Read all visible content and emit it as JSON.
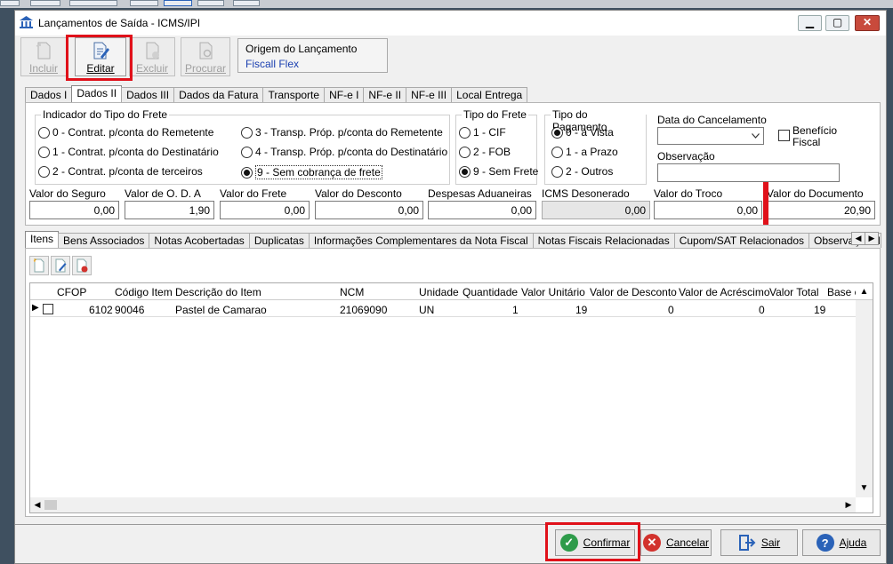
{
  "window": {
    "title": "Lançamentos de Saída - ICMS/IPI",
    "minimize": "▁",
    "maximize": "▢",
    "close": "✕"
  },
  "toolbar": {
    "incluir": "Incluir",
    "editar": "Editar",
    "excluir": "Excluir",
    "procurar": "Procurar"
  },
  "origin": {
    "label": "Origem do Lançamento",
    "value": "Fiscall Flex"
  },
  "tabs": [
    "Dados I",
    "Dados II",
    "Dados III",
    "Dados da Fatura",
    "Transporte",
    "NF-e I",
    "NF-e II",
    "NF-e III",
    "Local Entrega"
  ],
  "frete": {
    "title": "Indicador do Tipo do Frete",
    "options": [
      "0 - Contrat. p/conta do Remetente",
      "1 - Contrat. p/conta do Destinatário",
      "2 - Contrat. p/conta de terceiros",
      "3 - Transp. Próp. p/conta do Remetente",
      "4 - Transp. Próp. p/conta do Destinatário",
      "9 - Sem cobrança de frete"
    ],
    "selected": "9 - Sem cobrança de frete"
  },
  "tipo_frete": {
    "title": "Tipo do Frete",
    "options": [
      "1 - CIF",
      "2 - FOB",
      "9 - Sem Frete"
    ],
    "selected": "9 - Sem Frete"
  },
  "tipo_pagamento": {
    "title": "Tipo do Pagamento",
    "options": [
      "0 - à Vista",
      "1 - a Prazo",
      "2 - Outros"
    ],
    "selected": "0 - à Vista"
  },
  "cancelamento": {
    "label": "Data do Cancelamento",
    "value": ""
  },
  "beneficio": {
    "label1": "Benefício",
    "label2": "Fiscal",
    "checked": false
  },
  "observacao": {
    "label": "Observação",
    "value": ""
  },
  "valores": [
    {
      "label": "Valor do Seguro",
      "value": "0,00"
    },
    {
      "label": "Valor de O. D. A",
      "value": "1,90"
    },
    {
      "label": "Valor do Frete",
      "value": "0,00"
    },
    {
      "label": "Valor do Desconto",
      "value": "0,00"
    },
    {
      "label": "Despesas Aduaneiras",
      "value": "0,00"
    },
    {
      "label": "ICMS Desonerado",
      "value": "0,00"
    },
    {
      "label": "Valor do Troco",
      "value": "0,00"
    },
    {
      "label": "Valor do Documento",
      "value": "20,90"
    }
  ],
  "subtabs": [
    "Itens",
    "Bens Associados",
    "Notas Acobertadas",
    "Duplicatas",
    "Informações Complementares da Nota Fiscal",
    "Notas Fiscais Relacionadas",
    "Cupom/SAT Relacionados",
    "Observação de"
  ],
  "grid": {
    "columns": [
      "CFOP",
      "Código Item",
      "Descrição do Item",
      "NCM",
      "Unidade",
      "Quantidade",
      "Valor Unitário",
      "Valor de Desconto",
      "Valor de Acréscimo",
      "Valor Total",
      "Base c"
    ],
    "rows": [
      [
        "6102",
        "90046",
        "Pastel de Camarao",
        "21069090",
        "UN",
        "1",
        "19",
        "0",
        "0",
        "19",
        ""
      ]
    ]
  },
  "buttons": {
    "confirmar": "Confirmar",
    "cancelar": "Cancelar",
    "sair": "Sair",
    "ajuda": "Ajuda"
  },
  "colors": {
    "highlight": "#e0111a",
    "link": "#1a3fb0",
    "confirm": "#2e9b4a",
    "cancel": "#d2322d",
    "help": "#2a62b8"
  }
}
